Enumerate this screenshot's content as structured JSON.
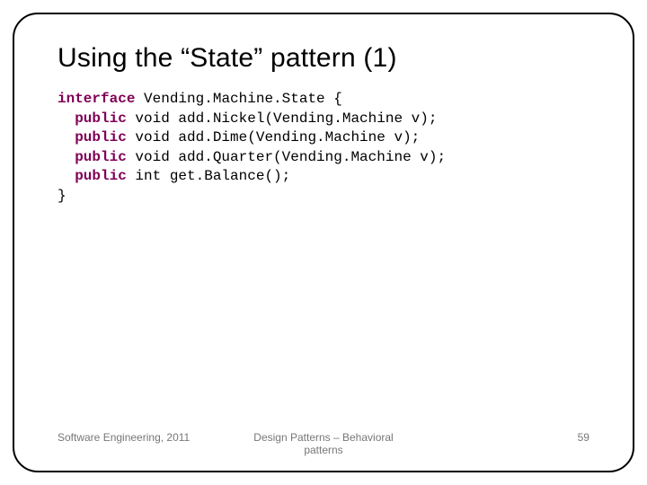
{
  "title": "Using the “State” pattern (1)",
  "code": {
    "kw_interface": "interface",
    "l1_text": " Vending.Machine.State {",
    "kw_public": "public",
    "l2_text": " void add.Nickel(Vending.Machine v);",
    "l3_text": " void add.Dime(Vending.Machine v);",
    "l4_text": " void add.Quarter(Vending.Machine v);",
    "l5_text": " int get.Balance();",
    "l6_text": "}"
  },
  "footer": {
    "left": "Software Engineering, 2011",
    "center": "Design Patterns – Behavioral patterns",
    "right": "59"
  }
}
